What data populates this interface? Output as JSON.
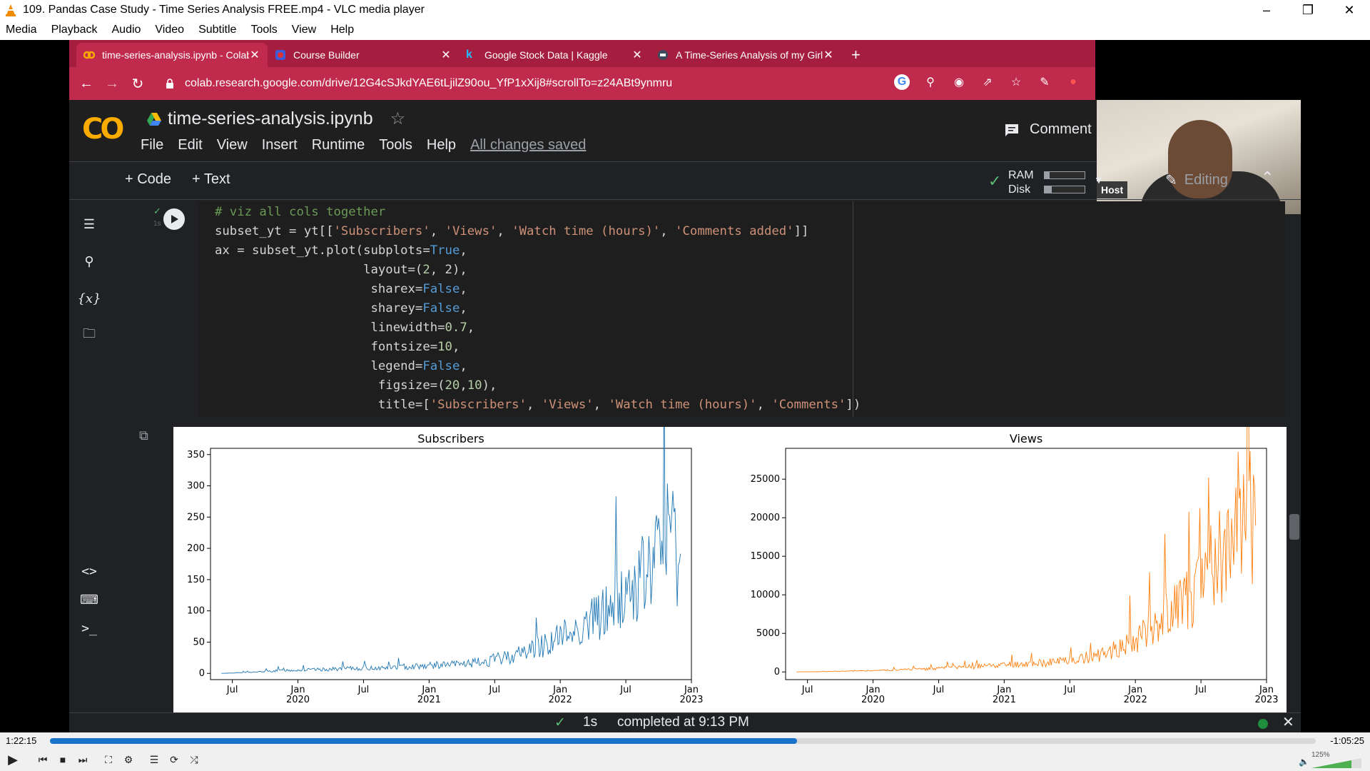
{
  "vlc": {
    "title": "109. Pandas Case Study - Time Series Analysis FREE.mp4 - VLC media player",
    "menu": [
      "Media",
      "Playback",
      "Audio",
      "Video",
      "Subtitle",
      "Tools",
      "View",
      "Help"
    ],
    "elapsed": "1:22:15",
    "remaining": "-1:05:25",
    "progress": 0.59,
    "volume": "125%"
  },
  "browser": {
    "tabs": [
      {
        "label": "time-series-analysis.ipynb - Colab",
        "favicon": "colab-icon"
      },
      {
        "label": "Course Builder",
        "favicon": "course-icon"
      },
      {
        "label": "Google Stock Data | Kaggle",
        "favicon": "kaggle-icon"
      },
      {
        "label": "A Time-Series Analysis of my Girl",
        "favicon": "globe-icon"
      }
    ],
    "url": "colab.research.google.com/drive/12G4cSJkdYAE6tLjilZ90ou_YfP1xXij8#scrollTo=z24ABt9ynmru",
    "tab_color": "#a61e3f"
  },
  "colab": {
    "notebook_title": "time-series-analysis.ipynb",
    "menu": [
      "File",
      "Edit",
      "View",
      "Insert",
      "Runtime",
      "Tools",
      "Help"
    ],
    "saved_status": "All changes saved",
    "comment_label": "Comment",
    "host_label": "Host",
    "add_code": "+ Code",
    "add_text": "+ Text",
    "ram_label": "RAM",
    "disk_label": "Disk",
    "ram_usage": 0.12,
    "disk_usage": 0.18,
    "editing_label": "Editing",
    "cell_time": "1s",
    "status_seconds": "1s",
    "status_message": "completed at 9:13 PM",
    "code_lines": [
      "# viz all cols together",
      "subset_yt = yt[['Subscribers', 'Views', 'Watch time (hours)', 'Comments added']]",
      "ax = subset_yt.plot(subplots=True,",
      "                    layout=(2, 2),",
      "                     sharex=False,",
      "                     sharey=False,",
      "                     linewidth=0.7,",
      "                     fontsize=10,",
      "                     legend=False,",
      "                      figsize=(20,10),",
      "                      title=['Subscribers', 'Views', 'Watch time (hours)', 'Comments'])"
    ]
  },
  "chart_data": [
    {
      "type": "line",
      "title": "Subscribers",
      "color": "#1f77b4",
      "x": [
        "2019-06",
        "2019-09",
        "2019-12",
        "2020-03",
        "2020-06",
        "2020-09",
        "2020-12",
        "2021-03",
        "2021-06",
        "2021-09",
        "2021-12",
        "2022-03",
        "2022-06",
        "2022-09",
        "2022-11",
        "2022-12"
      ],
      "values": [
        0,
        2,
        5,
        6,
        8,
        9,
        12,
        14,
        18,
        30,
        50,
        75,
        110,
        160,
        230,
        180
      ],
      "ylim": [
        -10,
        360
      ],
      "yticks": [
        0,
        50,
        100,
        150,
        200,
        250,
        300,
        350
      ],
      "xtick_labels": [
        "Jul",
        "Jan\n2020",
        "Jul",
        "Jan\n2021",
        "Jul",
        "Jan\n2022",
        "Jul",
        "Jan\n2023"
      ]
    },
    {
      "type": "line",
      "title": "Views",
      "color": "#ff7f0e",
      "x": [
        "2019-06",
        "2019-09",
        "2019-12",
        "2020-03",
        "2020-06",
        "2020-09",
        "2020-12",
        "2021-03",
        "2021-06",
        "2021-09",
        "2021-12",
        "2022-03",
        "2022-06",
        "2022-09",
        "2022-11",
        "2022-12"
      ],
      "values": [
        0,
        50,
        150,
        250,
        400,
        600,
        800,
        1000,
        1300,
        2000,
        3500,
        6000,
        10000,
        15000,
        24000,
        17000
      ],
      "ylim": [
        -1000,
        29000
      ],
      "yticks": [
        0,
        5000,
        10000,
        15000,
        20000,
        25000
      ],
      "xtick_labels": [
        "Jul",
        "Jan\n2020",
        "Jul",
        "Jan\n2021",
        "Jul",
        "Jan\n2022",
        "Jul",
        "Jan\n2023"
      ]
    }
  ]
}
